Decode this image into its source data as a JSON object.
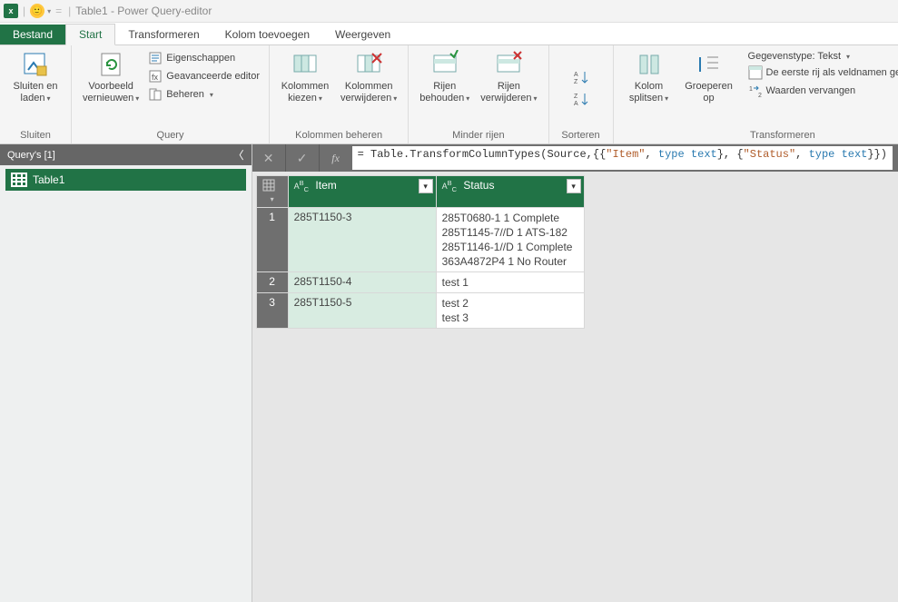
{
  "title": "Table1 - Power Query-editor",
  "tabs": {
    "file": "Bestand",
    "start": "Start",
    "transform": "Transformeren",
    "addcol": "Kolom toevoegen",
    "view": "Weergeven"
  },
  "ribbon": {
    "close": {
      "label": "Sluiten",
      "btn": "Sluiten en\nladen",
      "caret": "▾"
    },
    "query": {
      "label": "Query",
      "refresh": "Voorbeeld\nvernieuwen",
      "properties": "Eigenschappen",
      "advanced": "Geavanceerde editor",
      "manage": "Beheren"
    },
    "managecols": {
      "label": "Kolommen beheren",
      "choose": "Kolommen\nkiezen",
      "remove": "Kolommen\nverwijderen"
    },
    "reducerows": {
      "label": "Minder rijen",
      "keep": "Rijen\nbehouden",
      "remove": "Rijen\nverwijderen"
    },
    "sort": {
      "label": "Sorteren"
    },
    "transform": {
      "label": "Transformeren",
      "split": "Kolom\nsplitsen",
      "group": "Groeperen\nop",
      "datatype": "Gegevenstype: Tekst",
      "firstrow": "De eerste rij als veldnamen gebruiken",
      "replace": "Waarden vervangen"
    }
  },
  "sidebar": {
    "header": "Query's [1]",
    "item": "Table1"
  },
  "formula": {
    "prefix": "= Table.TransformColumnTypes(Source,{{",
    "str1": "\"Item\"",
    "sep1": ", ",
    "kw1a": "type",
    "kw1b": " text",
    "mid": "}, {",
    "str2": "\"Status\"",
    "sep2": ", ",
    "kw2a": "type",
    "kw2b": " text",
    "suffix": "}})"
  },
  "grid": {
    "columns": [
      "Item",
      "Status"
    ],
    "rows": [
      {
        "n": "1",
        "item": "285T1150-3",
        "status": [
          "285T0680-1 1 Complete",
          "285T1145-7//D 1 ATS-182",
          "285T1146-1//D 1 Complete",
          "363A4872P4 1 No Router"
        ]
      },
      {
        "n": "2",
        "item": "285T1150-4",
        "status": [
          "test 1"
        ]
      },
      {
        "n": "3",
        "item": "285T1150-5",
        "status": [
          "test 2",
          "test 3"
        ]
      }
    ]
  }
}
